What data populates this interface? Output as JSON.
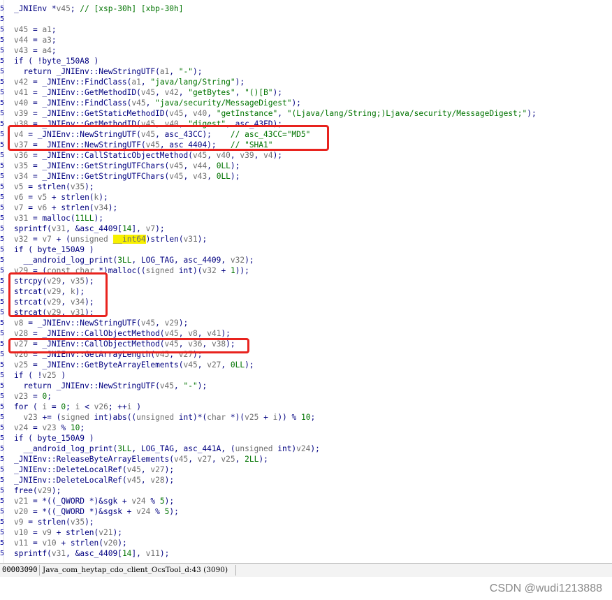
{
  "code": {
    "line_number_hint": "5",
    "lines": [
      "_JNIEnv *v45; // [xsp-30h] [xbp-30h]",
      "",
      "v45 = a1;",
      "v44 = a3;",
      "v43 = a4;",
      "if ( !byte_150A8 )",
      "  return _JNIEnv::NewStringUTF(a1, \"-\");",
      "v42 = _JNIEnv::FindClass(a1, \"java/lang/String\");",
      "v41 = _JNIEnv::GetMethodID(v45, v42, \"getBytes\", \"()[B\");",
      "v40 = _JNIEnv::FindClass(v45, \"java/security/MessageDigest\");",
      "v39 = _JNIEnv::GetStaticMethodID(v45, v40, \"getInstance\", \"(Ljava/lang/String;)Ljava/security/MessageDigest;\");",
      "v38 = _JNIEnv::GetMethodID(v45, v40, \"digest\", asc_43FD);",
      "v4 = _JNIEnv::NewStringUTF(v45, asc_43CC);    // asc_43CC=\"MD5\"",
      "v37 = _JNIEnv::NewStringUTF(v45, asc_4404);   // \"SHA1\"",
      "v36 = _JNIEnv::CallStaticObjectMethod(v45, v40, v39, v4);",
      "v35 = _JNIEnv::GetStringUTFChars(v45, v44, 0LL);",
      "v34 = _JNIEnv::GetStringUTFChars(v45, v43, 0LL);",
      "v5 = strlen(v35);",
      "v6 = v5 + strlen(k);",
      "v7 = v6 + strlen(v34);",
      "v31 = malloc(11LL);",
      "sprintf(v31, &asc_4409[14], v7);",
      "v32 = v7 + (unsigned __int64)strlen(v31);",
      "if ( byte_150A9 )",
      "  __android_log_print(3LL, LOG_TAG, asc_4409, v32);",
      "v29 = (const char *)malloc((signed int)(v32 + 1));",
      "strcpy(v29, v35);",
      "strcat(v29, k);",
      "strcat(v29, v34);",
      "strcat(v29, v31);",
      "v8 = _JNIEnv::NewStringUTF(v45, v29);",
      "v28 = _JNIEnv::CallObjectMethod(v45, v8, v41);",
      "v27 = _JNIEnv::CallObjectMethod(v45, v36, v38);",
      "v26 = _JNIEnv::GetArrayLength(v45, v27);",
      "v25 = _JNIEnv::GetByteArrayElements(v45, v27, 0LL);",
      "if ( !v25 )",
      "  return _JNIEnv::NewStringUTF(v45, \"-\");",
      "v23 = 0;",
      "for ( i = 0; i < v26; ++i )",
      "  v23 += (signed int)abs((unsigned int)*(char *)(v25 + i)) % 10;",
      "v24 = v23 % 10;",
      "if ( byte_150A9 )",
      "  __android_log_print(3LL, LOG_TAG, asc_441A, (unsigned int)v24);",
      "_JNIEnv::ReleaseByteArrayElements(v45, v27, v25, 2LL);",
      "_JNIEnv::DeleteLocalRef(v45, v27);",
      "_JNIEnv::DeleteLocalRef(v45, v28);",
      "free(v29);",
      "v21 = *((_QWORD *)&sgk + v24 % 5);",
      "v20 = *((_QWORD *)&sgsk + v24 % 5);",
      "v9 = strlen(v35);",
      "v10 = v9 + strlen(v21);",
      "v11 = v10 + strlen(v20);",
      "sprintf(v31, &asc_4409[14], v11);"
    ],
    "highlight_token": "__int64"
  },
  "statusbar": {
    "address": "00003090",
    "function": "Java_com_heytap_cdo_client_OcsTool_d:43 (3090)"
  },
  "watermark": "CSDN @wudi1213888",
  "colors": {
    "annotation_box": "#e8231e",
    "highlight": "#f7f000",
    "code_blue": "#000080",
    "variable_gray": "#6e6e6e",
    "string_green": "#007300"
  }
}
